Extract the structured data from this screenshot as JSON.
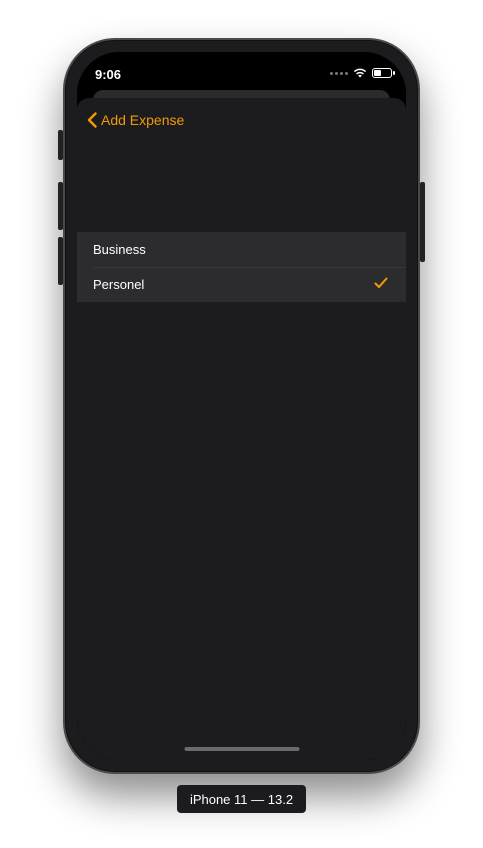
{
  "status_bar": {
    "time": "9:06"
  },
  "navigation": {
    "back_label": "Add Expense"
  },
  "options": [
    {
      "label": "Business",
      "selected": false
    },
    {
      "label": "Personel",
      "selected": true
    }
  ],
  "device": {
    "label": "iPhone 11 — 13.2"
  },
  "colors": {
    "accent": "#F09A0A",
    "background": "#1C1C1E",
    "row": "#2C2C2E"
  },
  "icons": {
    "back": "chevron-left-icon",
    "check": "checkmark-icon"
  }
}
